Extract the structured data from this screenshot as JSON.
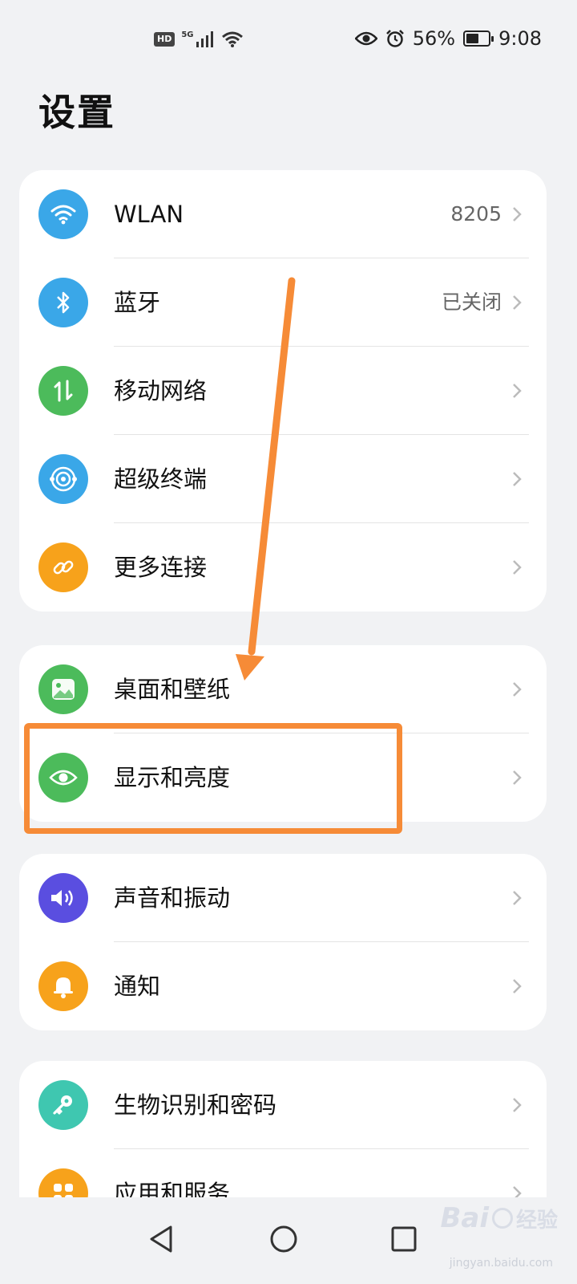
{
  "status_bar": {
    "hd": "HD",
    "network": "5G",
    "battery_percent": "56%",
    "battery_level": 0.56,
    "time": "9:08"
  },
  "title": "设置",
  "groups": [
    {
      "items": [
        {
          "label": "WLAN",
          "value": "8205",
          "icon": "wifi-icon",
          "color": "#3aa7e8"
        },
        {
          "label": "蓝牙",
          "value": "已关闭",
          "icon": "bluetooth-icon",
          "color": "#3aa7e8"
        },
        {
          "label": "移动网络",
          "value": "",
          "icon": "mobile-network-icon",
          "color": "#4cbb5b"
        },
        {
          "label": "超级终端",
          "value": "",
          "icon": "super-device-icon",
          "color": "#3aa7e8"
        },
        {
          "label": "更多连接",
          "value": "",
          "icon": "link-icon",
          "color": "#f7a21b"
        }
      ]
    },
    {
      "items": [
        {
          "label": "桌面和壁纸",
          "value": "",
          "icon": "wallpaper-icon",
          "color": "#4cbb5b"
        },
        {
          "label": "显示和亮度",
          "value": "",
          "icon": "eye-icon",
          "color": "#4cbb5b"
        }
      ]
    },
    {
      "items": [
        {
          "label": "声音和振动",
          "value": "",
          "icon": "sound-icon",
          "color": "#5a4ee0"
        },
        {
          "label": "通知",
          "value": "",
          "icon": "bell-icon",
          "color": "#f7a21b"
        }
      ]
    },
    {
      "items": [
        {
          "label": "生物识别和密码",
          "value": "",
          "icon": "key-icon",
          "color": "#3fc7b0"
        },
        {
          "label": "应用和服务",
          "value": "",
          "icon": "apps-icon",
          "color": "#f7a21b"
        }
      ]
    }
  ],
  "annotation": {
    "color": "#f68b37"
  },
  "nav": {
    "back": "back-icon",
    "home": "home-icon",
    "recents": "recents-icon"
  },
  "watermark": {
    "brand": "Bai",
    "brand2": "经验",
    "url": "jingyan.baidu.com"
  }
}
